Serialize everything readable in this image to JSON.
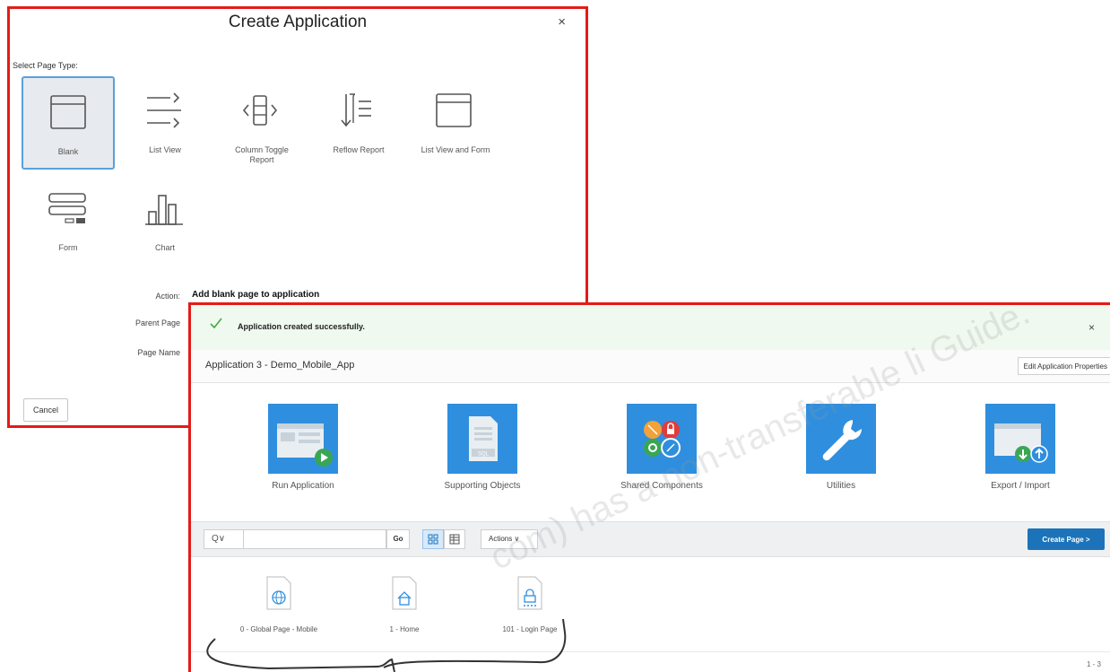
{
  "dialog": {
    "title": "Create Application",
    "close": "×",
    "select_label": "Select Page Type:",
    "page_types": [
      {
        "label": "Blank"
      },
      {
        "label": "List View"
      },
      {
        "label": "Column Toggle Report"
      },
      {
        "label": "Reflow Report"
      },
      {
        "label": "List View and Form"
      },
      {
        "label": "Form"
      },
      {
        "label": "Chart"
      }
    ],
    "action_label": "Action:",
    "action_value": "Add blank page to application",
    "parent_page_label": "Parent Page",
    "page_name_label": "Page Name",
    "cancel": "Cancel"
  },
  "apphome": {
    "success_message": "Application created successfully.",
    "close": "×",
    "app_title": "Application 3 - Demo_Mobile_App",
    "edit_properties": "Edit Application Properties",
    "tiles": [
      {
        "label": "Run Application"
      },
      {
        "label": "Supporting Objects"
      },
      {
        "label": "Shared Components"
      },
      {
        "label": "Utilities"
      },
      {
        "label": "Export / Import"
      }
    ],
    "toolbar": {
      "search_menu": "Q∨",
      "search_value": "",
      "go": "Go",
      "actions": "Actions ∨",
      "create_page": "Create Page >"
    },
    "pages": [
      {
        "label": "0 - Global Page - Mobile"
      },
      {
        "label": "1 - Home"
      },
      {
        "label": "101 - Login Page"
      }
    ],
    "pagination": "1 - 3",
    "accent": "#2f8fde"
  },
  "watermark": "com) has a non-transferable li    Guide."
}
